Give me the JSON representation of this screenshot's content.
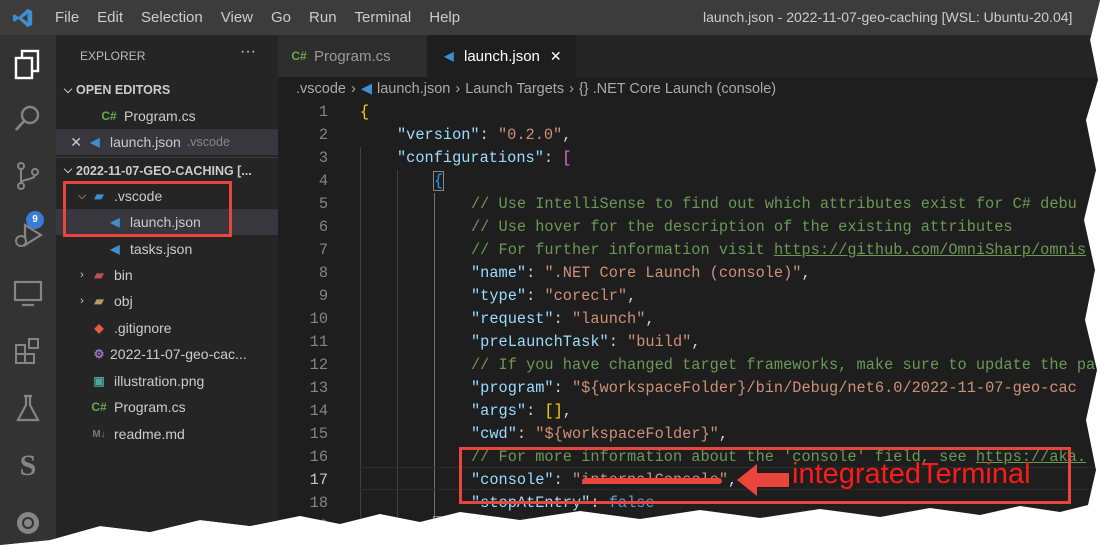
{
  "titlebar": {
    "menu": [
      "File",
      "Edit",
      "Selection",
      "View",
      "Go",
      "Run",
      "Terminal",
      "Help"
    ],
    "window_title": "launch.json - 2022-11-07-geo-caching [WSL: Ubuntu-20.04]"
  },
  "activity": {
    "scm_badge": "9"
  },
  "sidebar": {
    "title": "EXPLORER",
    "more": "···",
    "open_editors": "OPEN EDITORS",
    "open_files": [
      {
        "icon": "C#",
        "name": "Program.cs"
      },
      {
        "icon": "vscode",
        "name": "launch.json",
        "dir": ".vscode"
      }
    ],
    "folder": "2022-11-07-GEO-CACHING [...",
    "tree": [
      {
        "name": ".vscode"
      },
      {
        "name": "launch.json"
      },
      {
        "name": "tasks.json"
      },
      {
        "name": "bin"
      },
      {
        "name": "obj"
      },
      {
        "name": ".gitignore"
      },
      {
        "name": "2022-11-07-geo-cac..."
      },
      {
        "name": "illustration.png"
      },
      {
        "name": "Program.cs"
      },
      {
        "name": "readme.md"
      }
    ]
  },
  "tabs": [
    {
      "icon": "C#",
      "label": "Program.cs"
    },
    {
      "label": "launch.json",
      "close": "✕"
    }
  ],
  "breadcrumbs": [
    ".vscode",
    "launch.json",
    "Launch Targets",
    "{} .NET Core Launch (console)"
  ],
  "code": {
    "l2k": "\"version\"",
    "l2v": "\"0.2.0\"",
    "l3k": "\"configurations\"",
    "l5": "// Use IntelliSense to find out which attributes exist for C# debu",
    "l6": "// Use hover for the description of the existing attributes",
    "l7a": "// For further information visit ",
    "l7b": "https://github.com/OmniSharp/omnis",
    "l8k": "\"name\"",
    "l8v": "\".NET Core Launch (console)\"",
    "l9k": "\"type\"",
    "l9v": "\"coreclr\"",
    "l10k": "\"request\"",
    "l10v": "\"launch\"",
    "l11k": "\"preLaunchTask\"",
    "l11v": "\"build\"",
    "l12": "// If you have changed target frameworks, make sure to update the pa",
    "l13k": "\"program\"",
    "l13v": "\"${workspaceFolder}/bin/Debug/net6.0/2022-11-07-geo-cac",
    "l14k": "\"args\"",
    "l15k": "\"cwd\"",
    "l15v": "\"${workspaceFolder}\"",
    "l16a": "// For more information about the 'console' field, see ",
    "l16b": "https://aka.",
    "l17k": "\"console\"",
    "l17v": "\"internalConsole\"",
    "l18k": "\"stopAtEntry\"",
    "l18v": "false"
  },
  "annotation": "integratedTerminal"
}
